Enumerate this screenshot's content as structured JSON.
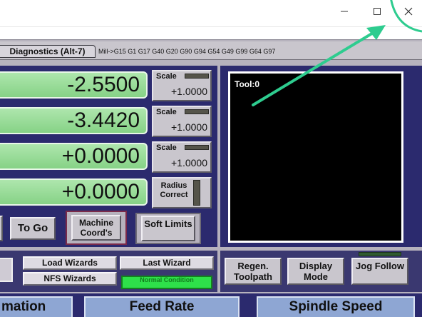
{
  "window": {
    "minimize_icon": "minimize-icon",
    "maximize_icon": "maximize-icon",
    "close_icon": "close-icon"
  },
  "tabs": {
    "diagnostics_label": "Diagnostics (Alt-7)"
  },
  "gcode_status": "Mill->G15  G1 G17 G40 G20 G90 G94 G54 G49 G99 G64 G97",
  "dro": {
    "rows": [
      {
        "value": "-2.5500",
        "scale_label": "Scale",
        "scale_value": "+1.0000"
      },
      {
        "value": "-3.4420",
        "scale_label": "Scale",
        "scale_value": "+1.0000"
      },
      {
        "value": "+0.0000",
        "scale_label": "Scale",
        "scale_value": "+1.0000"
      },
      {
        "value": "+0.0000",
        "radius_label": "Radius Correct"
      }
    ]
  },
  "buttons": {
    "to_go": "To Go",
    "machine_coords": "Machine Coord's",
    "soft_limits": "Soft Limits",
    "load_wizards": "Load Wizards",
    "last_wizard": "Last Wizard",
    "nfs_wizards": "NFS Wizards",
    "regen_toolpath": "Regen. Toolpath",
    "display_mode": "Display Mode",
    "jog_follow": "Jog Follow"
  },
  "status": {
    "condition": "Normal Condition"
  },
  "toolpath": {
    "tool_label": "Tool:0"
  },
  "bottom_headers": {
    "left": "mation",
    "feed_rate": "Feed Rate",
    "spindle_speed": "Spindle Speed"
  },
  "colors": {
    "annotation": "#2ecc8f",
    "dro_green": "#9cdf9b",
    "panel_blue": "#2b2a6e"
  }
}
